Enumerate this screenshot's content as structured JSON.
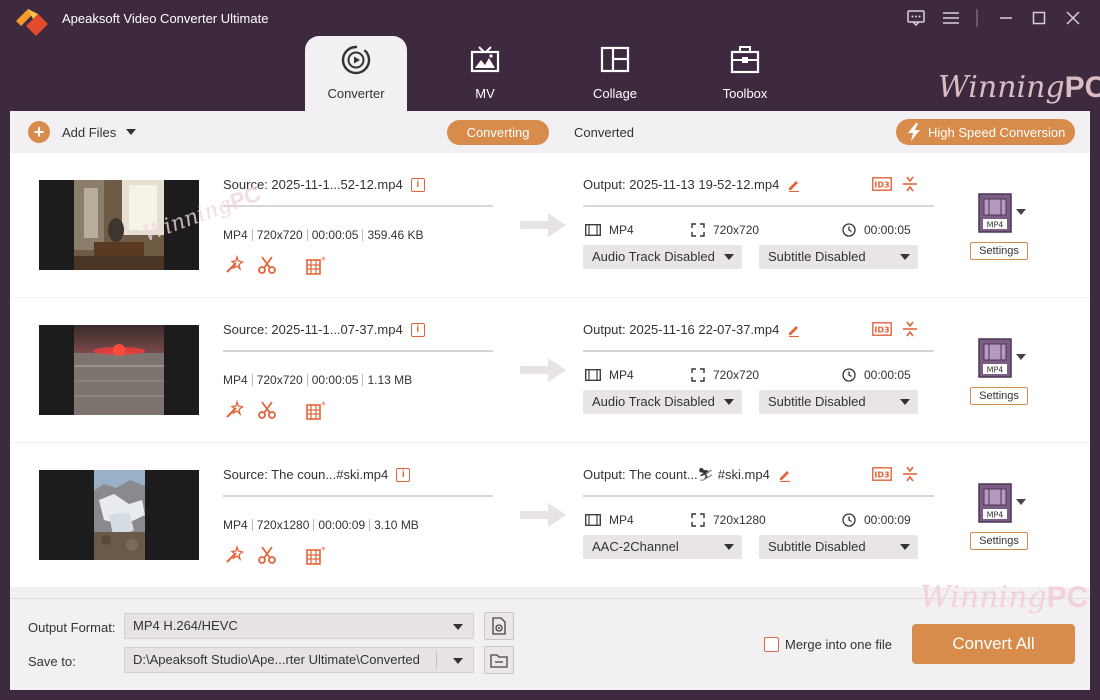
{
  "window": {
    "title": "Apeaksoft Video Converter Ultimate",
    "controls": [
      "feedback-icon",
      "menu-icon",
      "minimize-icon",
      "maximize-icon",
      "close-icon"
    ]
  },
  "nav": {
    "tabs": [
      {
        "label": "Converter",
        "icon": "converter-icon",
        "active": true
      },
      {
        "label": "MV",
        "icon": "mv-icon",
        "active": false
      },
      {
        "label": "Collage",
        "icon": "collage-icon",
        "active": false
      },
      {
        "label": "Toolbox",
        "icon": "toolbox-icon",
        "active": false
      }
    ]
  },
  "watermark": {
    "script": "Winning",
    "bold": "PC"
  },
  "toolbar": {
    "add_files": "Add Files",
    "converting": "Converting",
    "converted": "Converted",
    "high_speed": "High Speed Conversion"
  },
  "files": [
    {
      "source": "Source: 2025-11-1...52-12.mp4",
      "format": "MP4",
      "resolution": "720x720",
      "duration": "00:00:05",
      "size": "359.46 KB",
      "output": "Output: 2025-11-13 19-52-12.mp4",
      "out_format": "MP4",
      "out_resolution": "720x720",
      "out_duration": "00:00:05",
      "audio": "Audio Track Disabled",
      "subtitle": "Subtitle Disabled",
      "format_badge": "MP4",
      "settings": "Settings"
    },
    {
      "source": "Source: 2025-11-1...07-37.mp4",
      "format": "MP4",
      "resolution": "720x720",
      "duration": "00:00:05",
      "size": "1.13 MB",
      "output": "Output: 2025-11-16 22-07-37.mp4",
      "out_format": "MP4",
      "out_resolution": "720x720",
      "out_duration": "00:00:05",
      "audio": "Audio Track Disabled",
      "subtitle": "Subtitle Disabled",
      "format_badge": "MP4",
      "settings": "Settings"
    },
    {
      "source": "Source: The coun...#ski.mp4",
      "format": "MP4",
      "resolution": "720x1280",
      "duration": "00:00:09",
      "size": "3.10 MB",
      "output": "Output: The count...⛷ #ski.mp4",
      "out_format": "MP4",
      "out_resolution": "720x1280",
      "out_duration": "00:00:09",
      "audio": "AAC-2Channel",
      "subtitle": "Subtitle Disabled",
      "format_badge": "MP4",
      "settings": "Settings"
    }
  ],
  "bottom": {
    "output_format_label": "Output Format:",
    "output_format_value": "MP4 H.264/HEVC",
    "save_to_label": "Save to:",
    "save_to_value": "D:\\Apeaksoft Studio\\Ape...rter Ultimate\\Converted",
    "merge_label": "Merge into one file",
    "convert_all": "Convert All"
  },
  "colors": {
    "accent": "#d78c4c",
    "chrome": "#3d2a3e",
    "icon_red": "#e2643a"
  }
}
